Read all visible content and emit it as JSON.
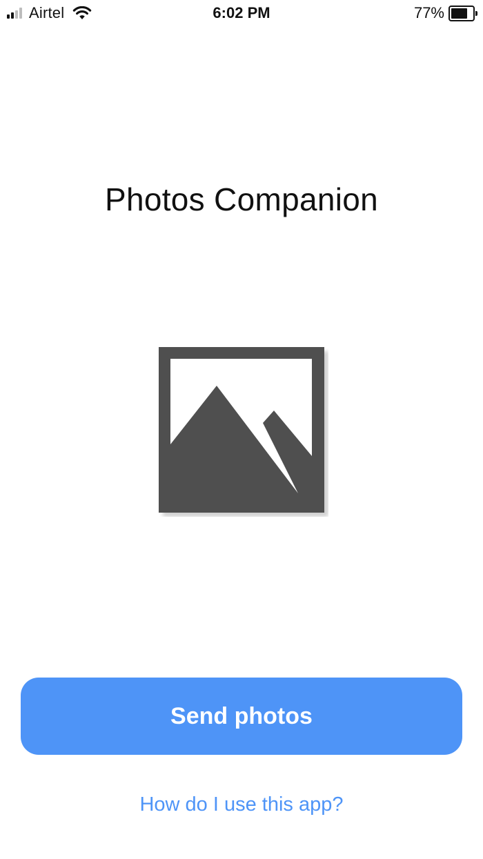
{
  "status_bar": {
    "carrier": "Airtel",
    "time": "6:02 PM",
    "battery_percent_label": "77%",
    "battery_level": 0.77,
    "signal_bars_filled": 2,
    "signal_bars_total": 4,
    "wifi_icon": "wifi-icon",
    "battery_icon": "battery-icon"
  },
  "main": {
    "title": "Photos Companion",
    "illustration_icon": "photo-icon"
  },
  "actions": {
    "send_label": "Send photos",
    "help_label": "How do I use this app?"
  },
  "colors": {
    "accent": "#4e94f7",
    "icon_gray": "#4f4f4f",
    "text": "#111111",
    "background": "#ffffff"
  }
}
